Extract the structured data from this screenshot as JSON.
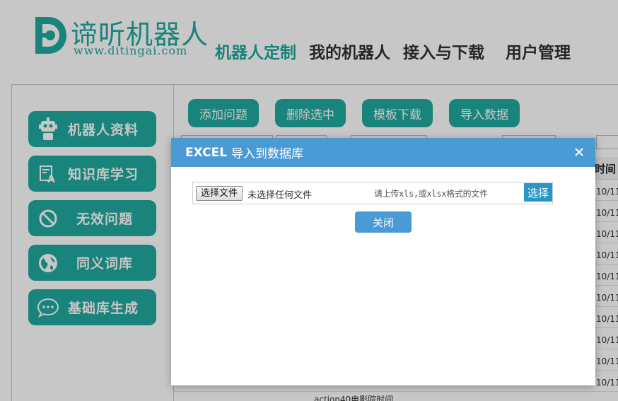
{
  "brand": {
    "name": "谛听机器人",
    "url": "www.ditingai.com",
    "color": "#1fa99e"
  },
  "nav": [
    {
      "label": "机器人定制",
      "active": true
    },
    {
      "label": "我的机器人",
      "active": false
    },
    {
      "label": "接入与下载",
      "active": false
    },
    {
      "label": "用户管理",
      "active": false
    }
  ],
  "sidebar": {
    "items": [
      {
        "label": "机器人资料",
        "icon": "robot-icon"
      },
      {
        "label": "知识库学习",
        "icon": "knowledge-icon"
      },
      {
        "label": "无效问题",
        "icon": "ban-icon"
      },
      {
        "label": "同义词库",
        "icon": "globe-icon"
      },
      {
        "label": "基础库生成",
        "icon": "chat-bubble-icon"
      }
    ]
  },
  "toolbar": {
    "add_label": "添加问题",
    "delete_label": "删除选中",
    "template_label": "模板下载",
    "import_label": "导入数据"
  },
  "table": {
    "time_header": "时间",
    "dates": [
      "10/11",
      "10/11",
      "10/11",
      "10/11",
      "10/11",
      "10/11",
      "10/11",
      "10/11",
      "10/11",
      "10/11"
    ],
    "partial_row_text": "action40电影院时间"
  },
  "modal": {
    "title_prefix": "EXCEL",
    "title_rest": "导入到数据库",
    "file_button": "选择文件",
    "file_status": "未选择任何文件",
    "hint": "请上传xls,或xlsx格式的文件",
    "select_button": "选择",
    "close_button": "关闭",
    "header_color": "#4a9ad6"
  }
}
